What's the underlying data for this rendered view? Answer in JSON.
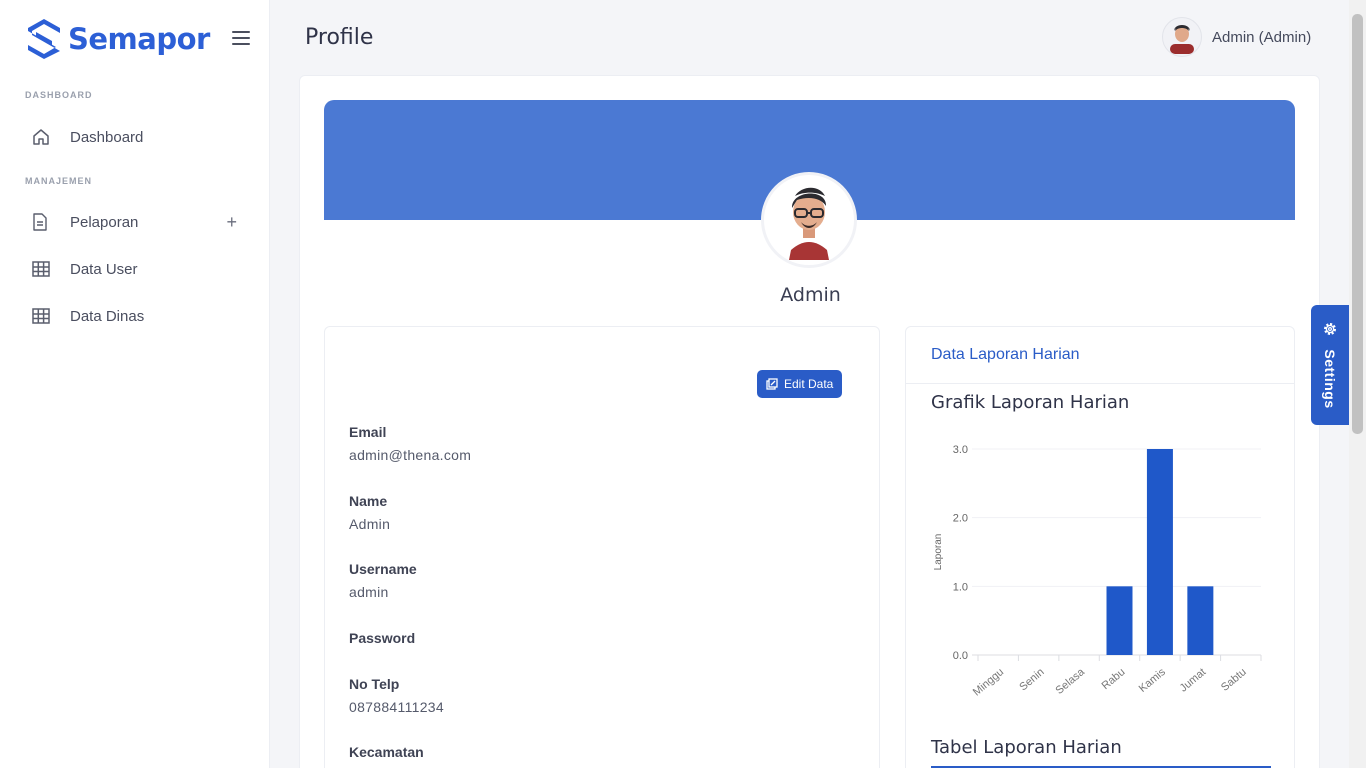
{
  "brand": {
    "name": "Semapor"
  },
  "sidebar": {
    "sections": [
      {
        "header": "DASHBOARD"
      },
      {
        "header": "MANAJEMEN"
      }
    ],
    "items": [
      {
        "label": "Dashboard",
        "icon": "home-icon"
      },
      {
        "label": "Pelaporan",
        "icon": "document-icon",
        "expand": "+"
      },
      {
        "label": "Data User",
        "icon": "table-icon"
      },
      {
        "label": "Data Dinas",
        "icon": "table-icon"
      }
    ]
  },
  "header": {
    "title": "Profile",
    "user": "Admin (Admin)"
  },
  "profile": {
    "name": "Admin",
    "cover_color": "#4b79d3",
    "edit_button": "Edit Data",
    "fields": [
      {
        "label": "Email",
        "value": "admin@thena.com"
      },
      {
        "label": "Name",
        "value": "Admin"
      },
      {
        "label": "Username",
        "value": "admin"
      },
      {
        "label": "Password",
        "value": ""
      },
      {
        "label": "No Telp",
        "value": "087884111234"
      },
      {
        "label": "Kecamatan",
        "value": ""
      }
    ]
  },
  "report_card": {
    "header": "Data Laporan Harian",
    "chart_title": "Grafik Laporan Harian",
    "table_title": "Tabel Laporan Harian"
  },
  "settings": {
    "label": "Settings"
  },
  "colors": {
    "accent": "#2a5cc7",
    "bar": "#1f58c9"
  },
  "chart_data": {
    "type": "bar",
    "categories": [
      "Minggu",
      "Senin",
      "Selasa",
      "Rabu",
      "Kamis",
      "Jumat",
      "Sabtu"
    ],
    "values": [
      0,
      0,
      0,
      1,
      3,
      1,
      0
    ],
    "ylabel": "Laporan",
    "yticks": [
      "0.0",
      "1.0",
      "2.0",
      "3.0"
    ],
    "ylim": [
      0,
      3
    ],
    "grid": true
  }
}
